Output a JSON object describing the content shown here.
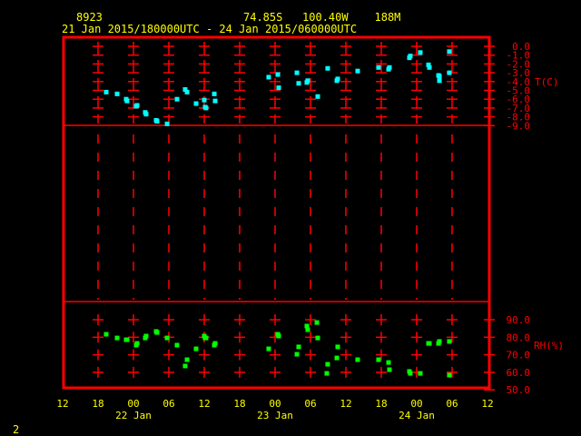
{
  "header": {
    "station": "8923",
    "location": "74.85S   100.40W    188M",
    "time_range": "21 Jan 2015/180000UTC - 24 Jan 2015/060000UTC"
  },
  "page_number": "2",
  "colors": {
    "frame": "#ff0000",
    "text": "#ffff00",
    "temperature": "#00ffff",
    "humidity": "#00ff00"
  },
  "chart_data": [
    {
      "type": "scatter",
      "panel": "top",
      "ylabel": "T(C)",
      "ylim": [
        -9.0,
        0.0
      ],
      "yticks": [
        "0.0",
        "-1.0",
        "-2.0",
        "-3.0",
        "-4.0",
        "-5.0",
        "-6.0",
        "-7.0",
        "-8.0",
        "-9.0"
      ],
      "xlim": [
        "2015-01-21T12:00Z",
        "2015-01-24T12:00Z"
      ],
      "points": [
        [
          "2015-01-21T19:23Z",
          -5.2
        ],
        [
          "2015-01-21T21:14Z",
          -5.4
        ],
        [
          "2015-01-21T22:46Z",
          -6.0
        ],
        [
          "2015-01-21T22:55Z",
          -6.2
        ],
        [
          "2015-01-22T00:28Z",
          -6.8
        ],
        [
          "2015-01-22T00:37Z",
          -6.7
        ],
        [
          "2015-01-22T02:00Z",
          -7.5
        ],
        [
          "2015-01-22T02:09Z",
          -7.7
        ],
        [
          "2015-01-22T03:51Z",
          -8.4
        ],
        [
          "2015-01-22T04:00Z",
          -8.5
        ],
        [
          "2015-01-22T05:42Z",
          -8.8
        ],
        [
          "2015-01-22T07:23Z",
          -6.0
        ],
        [
          "2015-01-22T08:46Z",
          -4.9
        ],
        [
          "2015-01-22T09:05Z",
          -5.2
        ],
        [
          "2015-01-22T10:37Z",
          -6.5
        ],
        [
          "2015-01-22T12:00Z",
          -6.1
        ],
        [
          "2015-01-22T12:09Z",
          -6.9
        ],
        [
          "2015-01-22T12:18Z",
          -7.0
        ],
        [
          "2015-01-22T13:42Z",
          -5.4
        ],
        [
          "2015-01-22T13:51Z",
          -6.2
        ],
        [
          "2015-01-22T22:55Z",
          -3.5
        ],
        [
          "2015-01-23T00:28Z",
          -3.2
        ],
        [
          "2015-01-23T00:37Z",
          -4.7
        ],
        [
          "2015-01-23T03:42Z",
          -3.0
        ],
        [
          "2015-01-23T04:00Z",
          -4.2
        ],
        [
          "2015-01-23T05:23Z",
          -4.1
        ],
        [
          "2015-01-23T05:32Z",
          -3.9
        ],
        [
          "2015-01-23T07:14Z",
          -5.7
        ],
        [
          "2015-01-23T08:55Z",
          -2.5
        ],
        [
          "2015-01-23T10:28Z",
          -3.9
        ],
        [
          "2015-01-23T10:37Z",
          -3.7
        ],
        [
          "2015-01-23T14:00Z",
          -2.8
        ],
        [
          "2015-01-23T17:32Z",
          -2.4
        ],
        [
          "2015-01-23T19:14Z",
          -2.6
        ],
        [
          "2015-01-23T19:23Z",
          -2.4
        ],
        [
          "2015-01-23T22:46Z",
          -1.3
        ],
        [
          "2015-01-23T22:55Z",
          -1.1
        ],
        [
          "2015-01-24T00:37Z",
          -0.7
        ],
        [
          "2015-01-24T02:00Z",
          -2.1
        ],
        [
          "2015-01-24T02:09Z",
          -2.4
        ],
        [
          "2015-01-24T03:42Z",
          -3.3
        ],
        [
          "2015-01-24T03:51Z",
          -3.4
        ],
        [
          "2015-01-24T03:51Z",
          -3.9
        ],
        [
          "2015-01-24T05:32Z",
          -0.6
        ],
        [
          "2015-01-24T05:32Z",
          -3.0
        ]
      ]
    },
    {
      "type": "scatter",
      "panel": "bottom",
      "ylabel": "RH(%)",
      "ylim": [
        50.0,
        90.0
      ],
      "yticks": [
        "90.0",
        "80.0",
        "70.0",
        "60.0",
        "50.0"
      ],
      "xlim": [
        "2015-01-21T12:00Z",
        "2015-01-24T12:00Z"
      ],
      "points": [
        [
          "2015-01-21T19:23Z",
          81.7
        ],
        [
          "2015-01-21T21:14Z",
          79.6
        ],
        [
          "2015-01-21T22:46Z",
          78.6
        ],
        [
          "2015-01-21T22:55Z",
          78.6
        ],
        [
          "2015-01-22T00:28Z",
          75.5
        ],
        [
          "2015-01-22T00:37Z",
          76.5
        ],
        [
          "2015-01-22T02:00Z",
          79.6
        ],
        [
          "2015-01-22T02:09Z",
          80.7
        ],
        [
          "2015-01-22T03:51Z",
          83.3
        ],
        [
          "2015-01-22T04:00Z",
          82.7
        ],
        [
          "2015-01-22T05:42Z",
          79.6
        ],
        [
          "2015-01-22T07:23Z",
          75.5
        ],
        [
          "2015-01-22T08:46Z",
          63.6
        ],
        [
          "2015-01-22T09:05Z",
          67.2
        ],
        [
          "2015-01-22T10:37Z",
          73.4
        ],
        [
          "2015-01-22T12:00Z",
          80.7
        ],
        [
          "2015-01-22T12:09Z",
          79.6
        ],
        [
          "2015-01-22T12:18Z",
          79.6
        ],
        [
          "2015-01-22T13:42Z",
          75.5
        ],
        [
          "2015-01-22T13:51Z",
          76.5
        ],
        [
          "2015-01-22T22:55Z",
          73.4
        ],
        [
          "2015-01-23T00:28Z",
          81.7
        ],
        [
          "2015-01-23T00:37Z",
          80.7
        ],
        [
          "2015-01-23T03:42Z",
          70.3
        ],
        [
          "2015-01-23T04:00Z",
          74.5
        ],
        [
          "2015-01-23T05:23Z",
          86.4
        ],
        [
          "2015-01-23T05:32Z",
          84.3
        ],
        [
          "2015-01-23T07:05Z",
          88.4
        ],
        [
          "2015-01-23T07:14Z",
          79.6
        ],
        [
          "2015-01-23T08:46Z",
          59.4
        ],
        [
          "2015-01-23T08:55Z",
          64.6
        ],
        [
          "2015-01-23T10:28Z",
          68.2
        ],
        [
          "2015-01-23T10:37Z",
          74.5
        ],
        [
          "2015-01-23T14:00Z",
          67.2
        ],
        [
          "2015-01-23T17:32Z",
          67.2
        ],
        [
          "2015-01-23T19:14Z",
          65.6
        ],
        [
          "2015-01-23T19:23Z",
          61.5
        ],
        [
          "2015-01-23T22:46Z",
          60.5
        ],
        [
          "2015-01-23T22:55Z",
          59.4
        ],
        [
          "2015-01-24T00:37Z",
          59.4
        ],
        [
          "2015-01-24T02:00Z",
          76.5
        ],
        [
          "2015-01-24T02:09Z",
          76.5
        ],
        [
          "2015-01-24T03:42Z",
          76.5
        ],
        [
          "2015-01-24T03:51Z",
          77.6
        ],
        [
          "2015-01-24T05:32Z",
          77.6
        ],
        [
          "2015-01-24T05:32Z",
          58.4
        ]
      ]
    }
  ],
  "x_axis": {
    "hour_labels": [
      "12",
      "18",
      "00",
      "06",
      "12",
      "18",
      "00",
      "06",
      "12",
      "18",
      "00",
      "06",
      "12"
    ],
    "date_labels": [
      "22 Jan",
      "23 Jan",
      "24 Jan"
    ]
  }
}
